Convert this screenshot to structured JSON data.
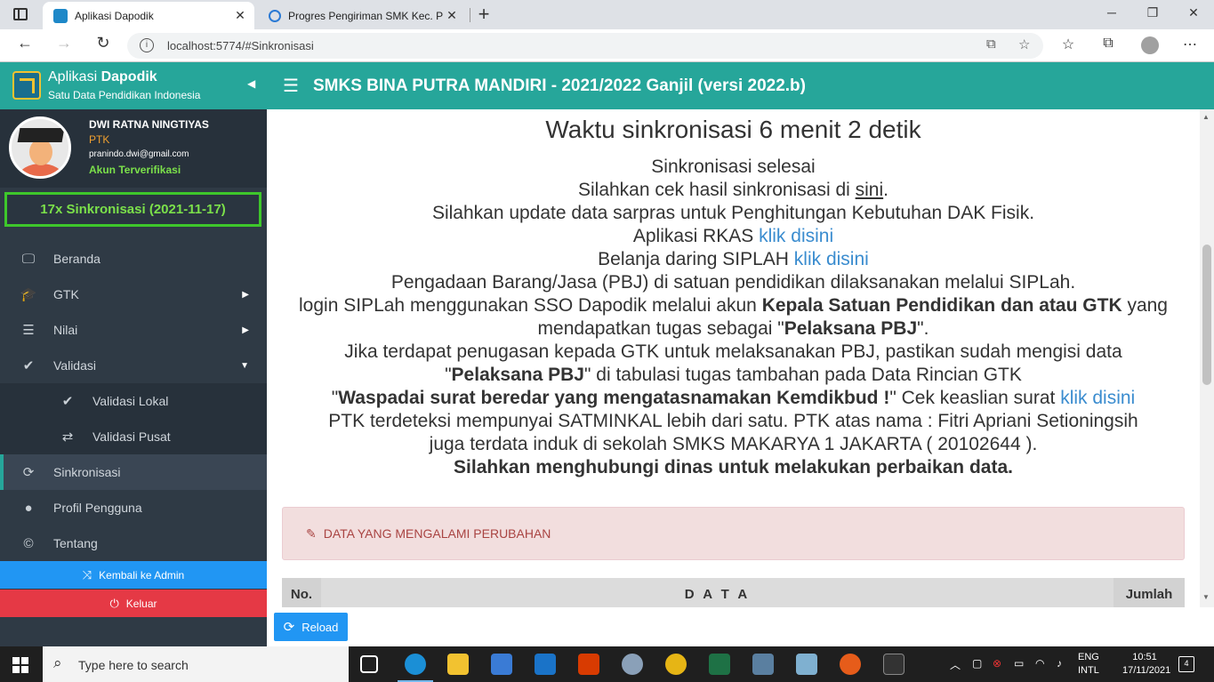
{
  "browser": {
    "tabs": [
      {
        "title": "Aplikasi Dapodik",
        "active": true
      },
      {
        "title": "Progres Pengiriman SMK Kec. Pa",
        "active": false
      }
    ],
    "url": "localhost:5774/#Sinkronisasi"
  },
  "brand": {
    "name_prefix": "Aplikasi ",
    "name_bold": "Dapodik",
    "subtitle": "Satu Data Pendidikan Indonesia"
  },
  "header": {
    "title": "SMKS BINA PUTRA MANDIRI - 2021/2022 Ganjil (versi 2022.b)"
  },
  "user": {
    "name": "DWI RATNA NINGTIYAS",
    "role": "PTK",
    "email": "pranindo.dwi@gmail.com",
    "status": "Akun Terverifikasi"
  },
  "sync_count": "17x Sinkronisasi (2021-11-17)",
  "sidebar": {
    "items": [
      {
        "label": "Beranda",
        "icon": "monitor-icon"
      },
      {
        "label": "GTK",
        "icon": "graduation-cap-icon"
      },
      {
        "label": "Nilai",
        "icon": "list-icon"
      },
      {
        "label": "Validasi",
        "icon": "check-icon"
      },
      {
        "label": "Validasi Lokal",
        "icon": "check-icon"
      },
      {
        "label": "Validasi Pusat",
        "icon": "exchange-icon"
      },
      {
        "label": "Sinkronisasi",
        "icon": "refresh-icon"
      },
      {
        "label": "Profil Pengguna",
        "icon": "user-icon"
      },
      {
        "label": "Tentang",
        "icon": "copyright-icon"
      }
    ],
    "admin_button": "Kembali ke Admin",
    "logout_button": "Keluar"
  },
  "content": {
    "heading": "Waktu sinkronisasi 6 menit 2 detik",
    "line1": "Sinkronisasi selesai",
    "line2_pre": "Silahkan cek hasil sinkronisasi di ",
    "line2_link": "sini",
    "line2_post": ".",
    "line3": "Silahkan update data sarpras untuk Penghitungan Kebutuhan DAK Fisik.",
    "line4_pre": "Aplikasi RKAS ",
    "line4_link": "klik disini",
    "line5_pre": "Belanja daring SIPLAH ",
    "line5_link": "klik disini",
    "line6": "Pengadaan Barang/Jasa (PBJ) di satuan pendidikan dilaksanakan melalui SIPLah.",
    "line7_pre": "login SIPLah menggunakan SSO Dapodik melalui akun ",
    "line7_bold": "Kepala Satuan Pendidikan dan atau GTK",
    "line7_mid": " yang mendapatkan tugas sebagai \"",
    "line7_bold2": "Pelaksana PBJ",
    "line7_post": "\".",
    "line8": "Jika terdapat penugasan kepada GTK untuk melaksanakan PBJ, pastikan sudah mengisi data",
    "line9_pre": "\"",
    "line9_bold": "Pelaksana PBJ",
    "line9_post": "\" di tabulasi tugas tambahan pada Data Rincian GTK",
    "line10_pre": "\"",
    "line10_bold": "Waspadai surat beredar yang mengatasnamakan Kemdikbud !",
    "line10_mid": "\" Cek keaslian surat ",
    "line10_link": "klik disini",
    "line11": "PTK terdeteksi mempunyai SATMINKAL lebih dari satu. PTK atas nama : Fitri Apriani Setioningsih",
    "line12": "juga terdata induk di sekolah SMKS MAKARYA 1 JAKARTA ( 20102644 ).",
    "line13": "Silahkan menghubungi dinas untuk melakukan perbaikan data.",
    "panel_title": "DATA YANG MENGALAMI PERUBAHAN",
    "table_headers": [
      "No.",
      "D A T A",
      "Jumlah"
    ],
    "reload_button": "Reload"
  },
  "taskbar": {
    "search_placeholder": "Type here to search",
    "lang1": "ENG",
    "lang2": "INTL",
    "time": "10:51",
    "date": "17/11/2021",
    "notifications": "4"
  },
  "colors": {
    "teal": "#26a69a",
    "sidebar": "#2f3a45",
    "blue_button": "#2196f3",
    "red_button": "#e53945",
    "green_sync": "#7be04a",
    "link": "#3a8ccf"
  }
}
